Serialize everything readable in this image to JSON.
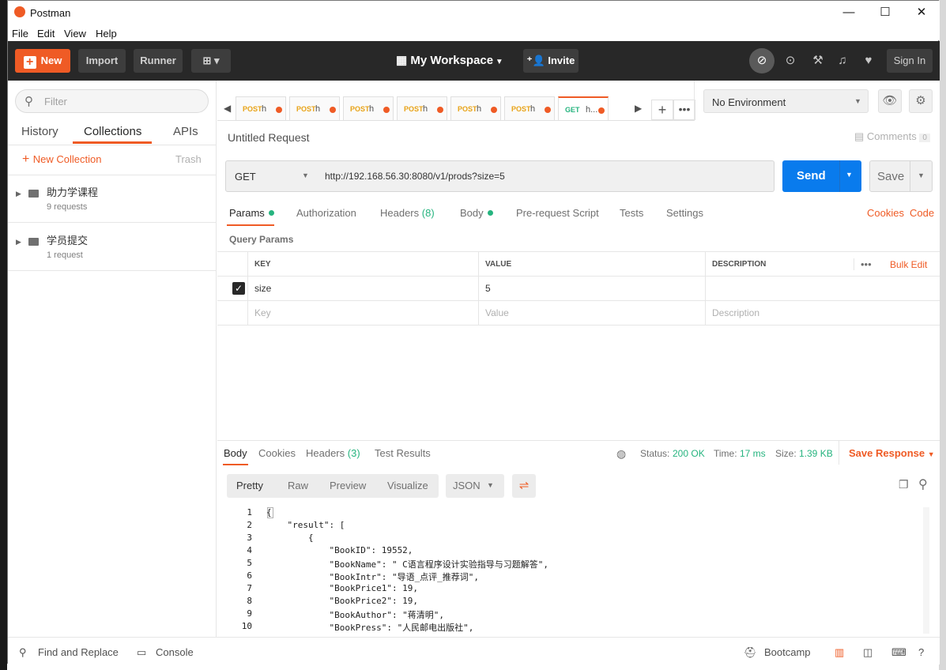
{
  "window": {
    "title": "Postman"
  },
  "menu": [
    "File",
    "Edit",
    "View",
    "Help"
  ],
  "header": {
    "new_label": "New",
    "import_label": "Import",
    "runner_label": "Runner",
    "workspace_label": "My Workspace",
    "invite_label": "Invite",
    "signin_label": "Sign In"
  },
  "sidebar": {
    "filter_placeholder": "Filter",
    "tabs": [
      "History",
      "Collections",
      "APIs"
    ],
    "active_tab": "Collections",
    "new_collection_label": "New Collection",
    "trash_label": "Trash",
    "collections": [
      {
        "name": "助力学课程",
        "count": "9 requests"
      },
      {
        "name": "学员提交",
        "count": "1 request"
      }
    ]
  },
  "request_tabs": [
    {
      "method": "POST",
      "url": "h"
    },
    {
      "method": "POST",
      "url": "h"
    },
    {
      "method": "POST",
      "url": "h"
    },
    {
      "method": "POST",
      "url": "h"
    },
    {
      "method": "POST",
      "url": "h"
    },
    {
      "method": "POST",
      "url": "h"
    },
    {
      "method": "GET",
      "url": "h..."
    }
  ],
  "environment": {
    "selected": "No Environment"
  },
  "request": {
    "title": "Untitled Request",
    "comments_label": "Comments",
    "comments_count": "0",
    "method": "GET",
    "url": "http://192.168.56.30:8080/v1/prods?size=5",
    "send_label": "Send",
    "save_label": "Save"
  },
  "param_tabs": {
    "params": "Params",
    "authorization": "Authorization",
    "headers": "Headers",
    "headers_count": "(8)",
    "body": "Body",
    "prerequest": "Pre-request Script",
    "tests": "Tests",
    "settings": "Settings",
    "cookies": "Cookies",
    "code": "Code"
  },
  "query_params": {
    "label": "Query Params",
    "col_key": "KEY",
    "col_value": "VALUE",
    "col_description": "DESCRIPTION",
    "bulk_edit": "Bulk Edit",
    "rows": [
      {
        "key": "size",
        "value": "5",
        "description": ""
      }
    ],
    "placeholder": {
      "key": "Key",
      "value": "Value",
      "description": "Description"
    }
  },
  "response": {
    "tabs": {
      "body": "Body",
      "cookies": "Cookies",
      "headers": "Headers",
      "headers_count": "(3)",
      "tests": "Test Results"
    },
    "status_label": "Status:",
    "status_value": "200 OK",
    "time_label": "Time:",
    "time_value": "17 ms",
    "size_label": "Size:",
    "size_value": "1.39 KB",
    "save_response": "Save Response",
    "view_tabs": [
      "Pretty",
      "Raw",
      "Preview",
      "Visualize"
    ],
    "format": "JSON",
    "code_lines": [
      "{",
      "    \"result\": [",
      "        {",
      "            \"BookID\": 19552,",
      "            \"BookName\": \" C语言程序设计实验指导与习题解答\",",
      "            \"BookIntr\": \"导语_点评_推荐词\",",
      "            \"BookPrice1\": 19,",
      "            \"BookPrice2\": 19,",
      "            \"BookAuthor\": \"蒋清明\",",
      "            \"BookPress\": \"人民邮电出版社\","
    ]
  },
  "footer": {
    "find_replace": "Find and Replace",
    "console": "Console",
    "bootcamp": "Bootcamp"
  },
  "colors": {
    "accent": "#ef5b25",
    "send": "#097bed",
    "ok": "#26b47f",
    "header_bg": "#282828"
  },
  "icons": [
    "search-icon",
    "globe-icon",
    "copy-icon",
    "eye-icon",
    "gear-icon",
    "bell-icon",
    "heart-icon",
    "wrench-icon",
    "satellite-icon",
    "sync-off-icon"
  ]
}
